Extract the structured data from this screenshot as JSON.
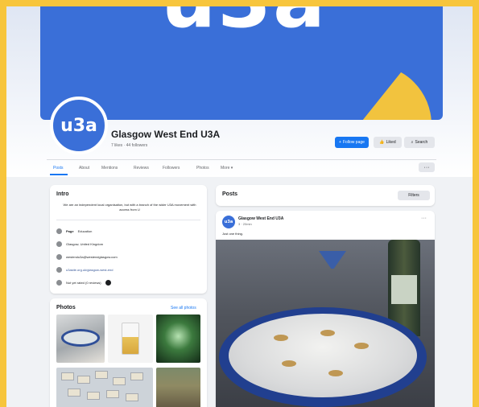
{
  "page": {
    "name": "Glasgow West End U3A",
    "meta": "7 likes · 44 followers",
    "avatar_text": "u3a",
    "cover_text": "u3a",
    "brand_color": "#3a6fd8",
    "accent_color": "#f2c33e"
  },
  "actions": {
    "follow": "Follow page",
    "liked": "Liked",
    "search": "Search"
  },
  "tabs": [
    "Posts",
    "About",
    "Mentions",
    "Reviews",
    "Followers",
    "Photos",
    "More ▾"
  ],
  "intro": {
    "title": "Intro",
    "description": "We are an independent local organisation, but with a branch of the wider U3A movement with access from U",
    "rows": {
      "page_label": "Page",
      "page_value": "Education",
      "location": "Glasgow, United Kingdom",
      "email": "westendu3a@westendglasgow.com",
      "website": "u3asite.org.uk/glasgow-west-end",
      "rating": "Not yet rated (0 reviews)"
    }
  },
  "photos": {
    "title": "Photos",
    "see_all": "See all photos"
  },
  "posts": {
    "title": "Posts",
    "filters": "Filters"
  },
  "post": {
    "author": "Glasgow West End U3A",
    "time": "3 · 20min",
    "text": "Just one thing."
  },
  "icons": {
    "follow": "follow-icon",
    "liked": "thumbs-up-icon",
    "search": "search-icon",
    "more": "more-icon"
  }
}
